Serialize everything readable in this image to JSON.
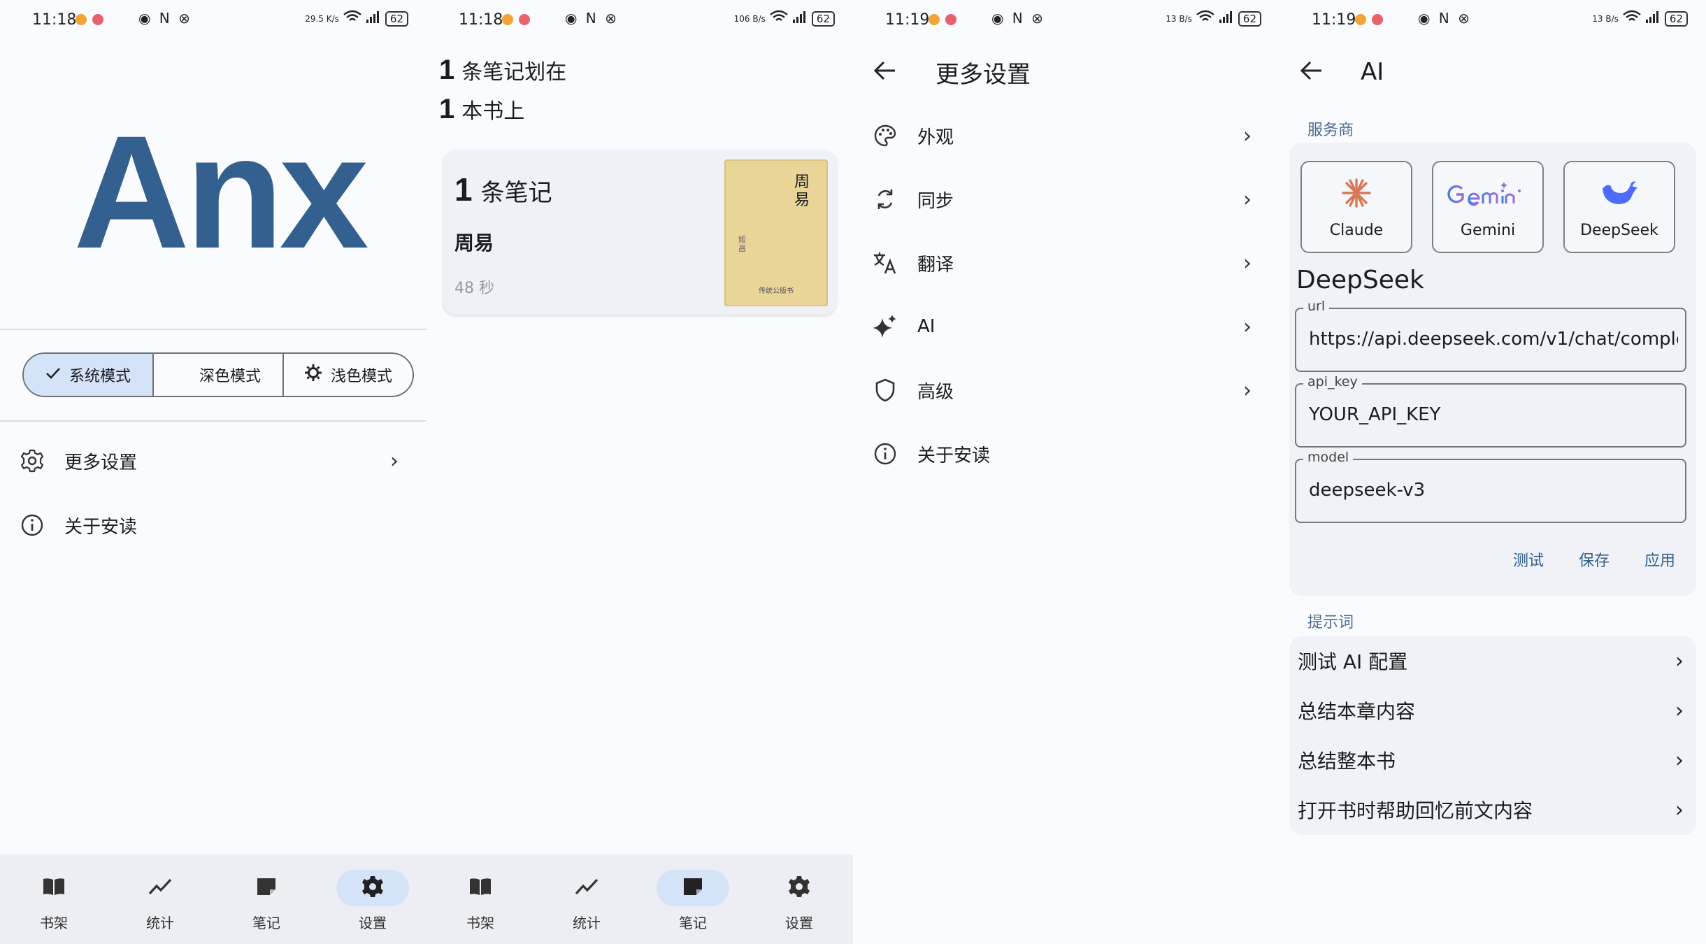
{
  "panels": [
    {
      "status_time": "11:18",
      "status_mid": "◉ N ⊗",
      "status_net": "29.5 K/s",
      "battery": "62"
    },
    {
      "status_time": "11:18",
      "status_mid": "◉ N ⊗",
      "status_net": "106 B/s",
      "battery": "62"
    },
    {
      "status_time": "11:19",
      "status_mid": "◉ N ⊗",
      "status_net": "13 B/s",
      "battery": "62"
    },
    {
      "status_time": "11:19",
      "status_mid": "◉ N ⊗",
      "status_net": "13 B/s",
      "battery": "62"
    }
  ],
  "settings_home": {
    "logo": "Anx",
    "theme_modes": [
      "系统模式",
      "深色模式",
      "浅色模式"
    ],
    "active_mode": "系统模式",
    "rows": [
      "更多设置",
      "关于安读"
    ]
  },
  "bottom_nav_left": {
    "items": [
      "书架",
      "统计",
      "笔记",
      "设置"
    ],
    "active": "设置"
  },
  "bottom_nav_right": {
    "items": [
      "书架",
      "统计",
      "笔记",
      "设置"
    ],
    "active": "笔记"
  },
  "notes": {
    "count_line1_num": "1",
    "count_line1_text": "条笔记划在",
    "count_line2_num": "1",
    "count_line2_text": "本书上",
    "card": {
      "count_num": "1",
      "count_text": "条笔记",
      "book_title": "周易",
      "duration": "48 秒",
      "cover_title": "周易",
      "cover_subtitle": "姬昌",
      "cover_footer": "传统公版书"
    }
  },
  "more_settings": {
    "title": "更多设置",
    "items": [
      "外观",
      "同步",
      "翻译",
      "AI",
      "高级",
      "关于安读"
    ]
  },
  "ai_settings": {
    "title": "AI",
    "providers_label": "服务商",
    "providers": [
      "Claude",
      "Gemini",
      "DeepSeek"
    ],
    "selected_name": "DeepSeek",
    "fields": [
      {
        "label": "url",
        "value": "https://api.deepseek.com/v1/chat/comple"
      },
      {
        "label": "api_key",
        "value": "YOUR_API_KEY"
      },
      {
        "label": "model",
        "value": "deepseek-v3"
      }
    ],
    "actions": [
      "测试",
      "保存",
      "应用"
    ],
    "prompts_label": "提示词",
    "prompts": [
      "测试 AI 配置",
      "总结本章内容",
      "总结整本书",
      "打开书时帮助回忆前文内容"
    ]
  },
  "colors": {
    "accent": "#33608f",
    "active_pill": "#d5e3f8",
    "nav_bg": "#eceef4",
    "cover": "#ead598"
  }
}
